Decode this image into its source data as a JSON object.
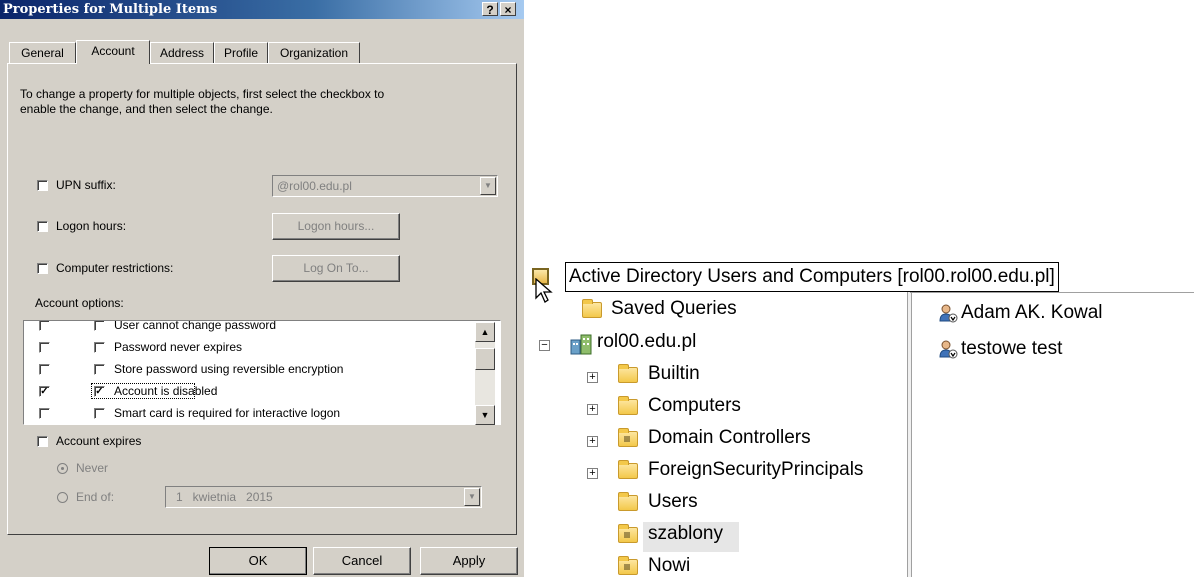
{
  "dialog": {
    "title": "Properties for Multiple Items",
    "help_btn": "?",
    "close_btn": "×",
    "tabs": [
      {
        "label": "General"
      },
      {
        "label": "Account",
        "active": true
      },
      {
        "label": "Address"
      },
      {
        "label": "Profile"
      },
      {
        "label": "Organization"
      }
    ],
    "intro_line1": "To change a property for multiple objects, first select the checkbox to",
    "intro_line2": "enable the change, and then select the change.",
    "upn_label": "UPN suffix:",
    "upn_value": "@rol00.edu.pl",
    "logon_hours_label": "Logon hours:",
    "logon_hours_btn": "Logon hours...",
    "computer_restrictions_label": "Computer restrictions:",
    "log_on_to_btn": "Log On To...",
    "account_options_label": "Account options:",
    "options": [
      {
        "label": "User cannot change password",
        "enable": false,
        "value": false
      },
      {
        "label": "Password never expires",
        "enable": false,
        "value": false
      },
      {
        "label": "Store password using reversible encryption",
        "enable": false,
        "value": false
      },
      {
        "label": "Account is disabled",
        "enable": true,
        "value": true
      },
      {
        "label": "Smart card is required for interactive logon",
        "enable": false,
        "value": false
      }
    ],
    "account_expires_label": "Account expires",
    "never_label": "Never",
    "end_of_label": "End of:",
    "end_of_date": "1   kwietnia   2015",
    "ok": "OK",
    "cancel": "Cancel",
    "apply": "Apply",
    "check_mark": "✓",
    "scroll_up": "▲",
    "scroll_down": "▼",
    "dropdown_arrow": "▼"
  },
  "aduc": {
    "root_label": "Active Directory Users and Computers [rol00.rol00.edu.pl]",
    "saved_queries": "Saved Queries",
    "domain": "rol00.edu.pl",
    "collapse_glyph": "−",
    "expand_glyph": "+",
    "containers": [
      {
        "label": "Builtin",
        "expandable": true,
        "type": "folder"
      },
      {
        "label": "Computers",
        "expandable": true,
        "type": "folder"
      },
      {
        "label": "Domain Controllers",
        "expandable": true,
        "type": "ou"
      },
      {
        "label": "ForeignSecurityPrincipals",
        "expandable": true,
        "type": "folder"
      },
      {
        "label": "Users",
        "expandable": false,
        "type": "folder"
      },
      {
        "label": "szablony",
        "expandable": false,
        "type": "ou",
        "selected": true
      },
      {
        "label": "Nowi",
        "expandable": false,
        "type": "ou"
      }
    ],
    "users": [
      {
        "name": "Adam AK. Kowal"
      },
      {
        "name": "testowe test"
      }
    ]
  }
}
